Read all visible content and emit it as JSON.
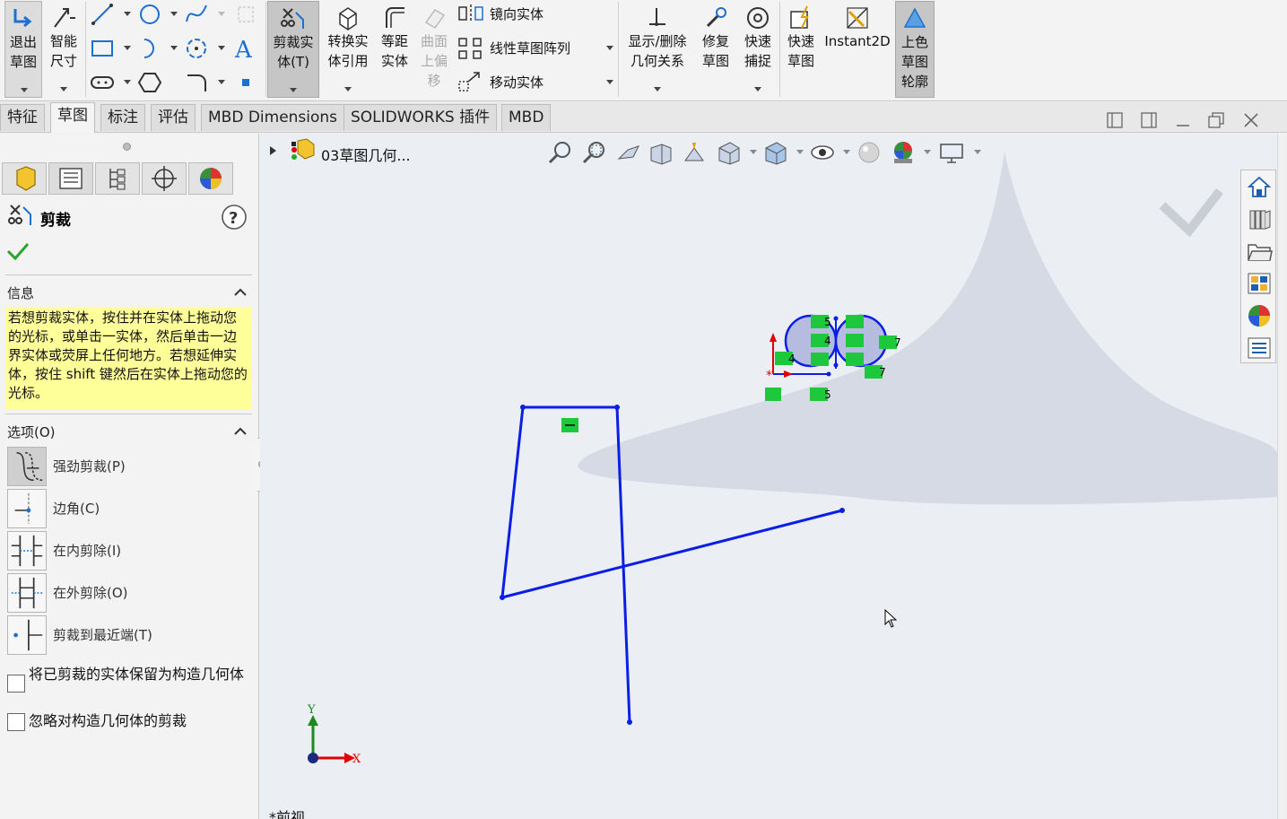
{
  "ribbon": {
    "exit_sketch": [
      "退出",
      "草图"
    ],
    "smart_dimension": [
      "智能",
      "尺寸"
    ],
    "trim_entities": [
      "剪裁实",
      "体(T)"
    ],
    "convert_entities": [
      "转换实",
      "体引用"
    ],
    "offset_entities": [
      "等距",
      "实体"
    ],
    "offset_surface": [
      "曲面",
      "上偏",
      "移"
    ],
    "mirror_entities": "镜向实体",
    "linear_pattern": "线性草图阵列",
    "move_entities": "移动实体",
    "display_relations": [
      "显示/删除",
      "几何关系"
    ],
    "repair_sketch": [
      "修复",
      "草图"
    ],
    "quick_snaps": [
      "快速",
      "捕捉"
    ],
    "rapid_sketch": [
      "快速",
      "草图"
    ],
    "instant2d": "Instant2D",
    "shaded_contours": [
      "上色",
      "草图",
      "轮廓"
    ]
  },
  "tabs": [
    "特征",
    "草图",
    "标注",
    "评估",
    "MBD Dimensions",
    "SOLIDWORKS 插件",
    "MBD"
  ],
  "tree": {
    "part_name": "03草图几何..."
  },
  "panel": {
    "title": "剪裁",
    "info_header": "信息",
    "info_text": "若想剪裁实体，按住并在实体上拖动您的光标，或单击一实体，然后单击一边界实体或荧屏上任何地方。若想延伸实体，按住 shift 键然后在实体上拖动您的光标。",
    "options_header": "选项(O)",
    "options": [
      {
        "label": "强劲剪裁(P)",
        "selected": true
      },
      {
        "label": "边角(C)",
        "selected": false
      },
      {
        "label": "在内剪除(I)",
        "selected": false
      },
      {
        "label": "在外剪除(O)",
        "selected": false
      },
      {
        "label": "剪裁到最近端(T)",
        "selected": false
      }
    ],
    "checkbox_keep_construction": "将已剪裁的实体保留为构造几何体",
    "checkbox_ignore_construction": "忽略对构造几何体的剪裁"
  },
  "sketch_labels": {
    "relation_equal": "=",
    "dims": [
      "5",
      "4",
      "7",
      "4",
      "7",
      "5"
    ]
  },
  "triad": {
    "y": "Y",
    "x": "X"
  },
  "view_name": "*前视",
  "colors": {
    "sketch_blue": "#0a1ee6",
    "relation_green": "#1ec83c",
    "info_yellow": "#ffff9a",
    "accent_active": "#c6c6c6"
  }
}
